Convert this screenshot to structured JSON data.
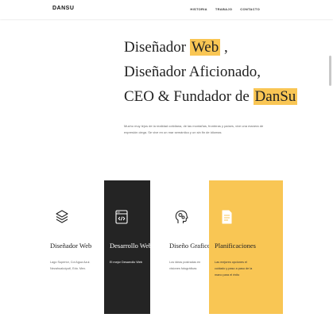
{
  "nav": {
    "logo": "DANSU",
    "menu": [
      "HISTORIA",
      "TRABAJO",
      "CONTACTO"
    ]
  },
  "hero": {
    "line1_text": "Diseñador",
    "line1_highlight": "Web",
    "line1_suffix": ",",
    "line2": "Diseñador Aficionado,",
    "line3_text": "CEO & Fundador de",
    "line3_highlight": "DanSu",
    "intro": "Mucho muy lejos de la realidad cotidiana, de las montañas, fronteras y países, vive una manera de expresión ciega. Se vive en un mar semántico y un sin fin de idiomas"
  },
  "cards": [
    {
      "icon": "layers-icon",
      "title": "Diseñador Web",
      "text": "Lago Superior, Col Agua Azul. Nezahualcóyotl, Edo. Mex."
    },
    {
      "icon": "code-window-icon",
      "title": "Desarrollo Web",
      "text": "El mejor Desarrollo Web"
    },
    {
      "icon": "head-gears-icon",
      "title": "Diseño Grafico",
      "text": "Los ideas postradas en visiones fotográficas"
    },
    {
      "icon": "document-icon",
      "title": "Planificaciones",
      "text": "Las mejores opciones el cuidado y paso a paso de la mano para el éxito"
    }
  ],
  "colors": {
    "accent": "#f9c654",
    "dark_card": "#242424",
    "text": "#222222"
  }
}
